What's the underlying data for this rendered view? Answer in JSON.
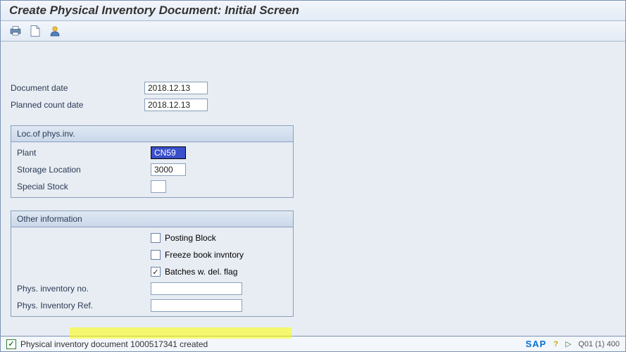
{
  "header": {
    "title": "Create Physical Inventory Document: Initial Screen"
  },
  "toolbar": {
    "print_tip": "Print",
    "new_tip": "New",
    "user_tip": "User"
  },
  "fields": {
    "doc_date_label": "Document date",
    "doc_date_value": "2018.12.13",
    "planned_date_label": "Planned count date",
    "planned_date_value": "2018.12.13"
  },
  "loc_group": {
    "title": "Loc.of phys.inv.",
    "plant_label": "Plant",
    "plant_value": "CN59",
    "sloc_label": "Storage Location",
    "sloc_value": "3000",
    "spstock_label": "Special Stock",
    "spstock_value": ""
  },
  "other_group": {
    "title": "Other information",
    "posting_block_label": "Posting Block",
    "posting_block_checked": false,
    "freeze_label": "Freeze book invntory",
    "freeze_checked": false,
    "batches_label": "Batches w. del. flag",
    "batches_checked": true,
    "pino_label": "Phys. inventory no.",
    "pino_value": "",
    "piref_label": "Phys. Inventory Ref.",
    "piref_value": ""
  },
  "status": {
    "message": "Physical inventory document 1000517341 created",
    "system": "Q01 (1) 400",
    "logo": "SAP"
  }
}
